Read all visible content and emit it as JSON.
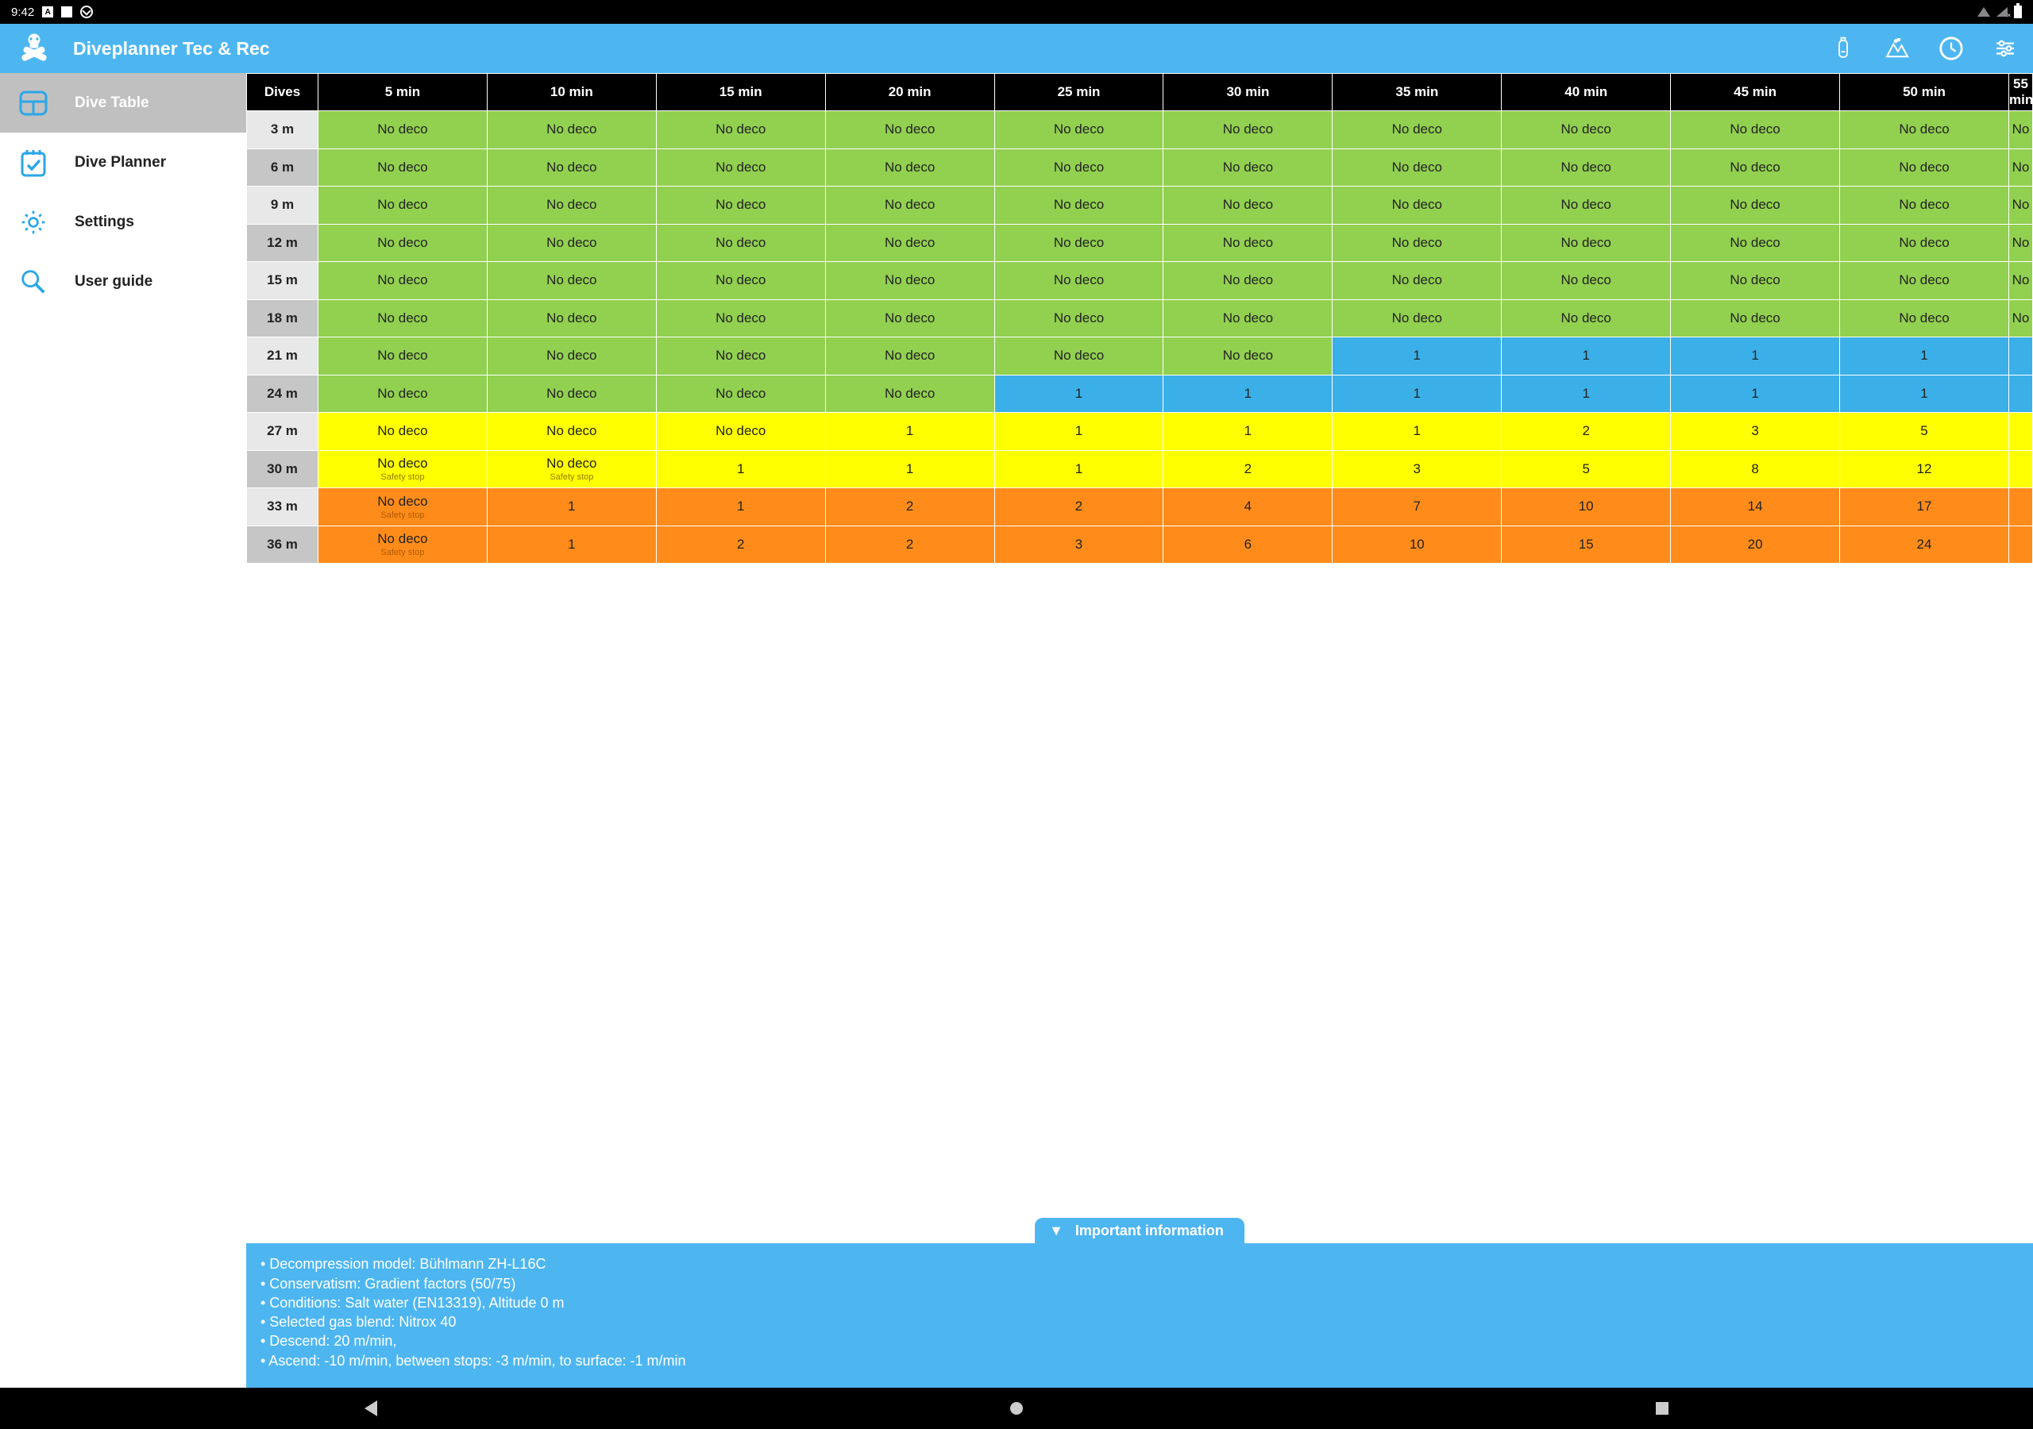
{
  "statusbar": {
    "time": "9:42"
  },
  "appbar": {
    "title": "Diveplanner Tec & Rec",
    "actions": [
      "tank",
      "altitude",
      "history",
      "settings"
    ]
  },
  "sidebar": {
    "items": [
      {
        "id": "dive-table",
        "label": "Dive Table",
        "active": true
      },
      {
        "id": "dive-planner",
        "label": "Dive Planner",
        "active": false
      },
      {
        "id": "settings",
        "label": "Settings",
        "active": false
      },
      {
        "id": "user-guide",
        "label": "User guide",
        "active": false
      }
    ]
  },
  "table": {
    "header_first": "Dives",
    "time_cols": [
      "5 min",
      "10 min",
      "15 min",
      "20 min",
      "25 min",
      "30 min",
      "35 min",
      "40 min",
      "45 min",
      "50 min",
      "55 min"
    ],
    "depths": [
      "3 m",
      "6 m",
      "9 m",
      "12 m",
      "15 m",
      "18 m",
      "21 m",
      "24 m",
      "27 m",
      "30 m",
      "33 m",
      "36 m"
    ],
    "cells": [
      [
        {
          "v": "No deco",
          "c": "nodeco"
        },
        {
          "v": "No deco",
          "c": "nodeco"
        },
        {
          "v": "No deco",
          "c": "nodeco"
        },
        {
          "v": "No deco",
          "c": "nodeco"
        },
        {
          "v": "No deco",
          "c": "nodeco"
        },
        {
          "v": "No deco",
          "c": "nodeco"
        },
        {
          "v": "No deco",
          "c": "nodeco"
        },
        {
          "v": "No deco",
          "c": "nodeco"
        },
        {
          "v": "No deco",
          "c": "nodeco"
        },
        {
          "v": "No deco",
          "c": "nodeco"
        },
        {
          "v": "No",
          "c": "nodeco"
        }
      ],
      [
        {
          "v": "No deco",
          "c": "nodeco"
        },
        {
          "v": "No deco",
          "c": "nodeco"
        },
        {
          "v": "No deco",
          "c": "nodeco"
        },
        {
          "v": "No deco",
          "c": "nodeco"
        },
        {
          "v": "No deco",
          "c": "nodeco"
        },
        {
          "v": "No deco",
          "c": "nodeco"
        },
        {
          "v": "No deco",
          "c": "nodeco"
        },
        {
          "v": "No deco",
          "c": "nodeco"
        },
        {
          "v": "No deco",
          "c": "nodeco"
        },
        {
          "v": "No deco",
          "c": "nodeco"
        },
        {
          "v": "No",
          "c": "nodeco"
        }
      ],
      [
        {
          "v": "No deco",
          "c": "nodeco"
        },
        {
          "v": "No deco",
          "c": "nodeco"
        },
        {
          "v": "No deco",
          "c": "nodeco"
        },
        {
          "v": "No deco",
          "c": "nodeco"
        },
        {
          "v": "No deco",
          "c": "nodeco"
        },
        {
          "v": "No deco",
          "c": "nodeco"
        },
        {
          "v": "No deco",
          "c": "nodeco"
        },
        {
          "v": "No deco",
          "c": "nodeco"
        },
        {
          "v": "No deco",
          "c": "nodeco"
        },
        {
          "v": "No deco",
          "c": "nodeco"
        },
        {
          "v": "No",
          "c": "nodeco"
        }
      ],
      [
        {
          "v": "No deco",
          "c": "nodeco"
        },
        {
          "v": "No deco",
          "c": "nodeco"
        },
        {
          "v": "No deco",
          "c": "nodeco"
        },
        {
          "v": "No deco",
          "c": "nodeco"
        },
        {
          "v": "No deco",
          "c": "nodeco"
        },
        {
          "v": "No deco",
          "c": "nodeco"
        },
        {
          "v": "No deco",
          "c": "nodeco"
        },
        {
          "v": "No deco",
          "c": "nodeco"
        },
        {
          "v": "No deco",
          "c": "nodeco"
        },
        {
          "v": "No deco",
          "c": "nodeco"
        },
        {
          "v": "No",
          "c": "nodeco"
        }
      ],
      [
        {
          "v": "No deco",
          "c": "nodeco"
        },
        {
          "v": "No deco",
          "c": "nodeco"
        },
        {
          "v": "No deco",
          "c": "nodeco"
        },
        {
          "v": "No deco",
          "c": "nodeco"
        },
        {
          "v": "No deco",
          "c": "nodeco"
        },
        {
          "v": "No deco",
          "c": "nodeco"
        },
        {
          "v": "No deco",
          "c": "nodeco"
        },
        {
          "v": "No deco",
          "c": "nodeco"
        },
        {
          "v": "No deco",
          "c": "nodeco"
        },
        {
          "v": "No deco",
          "c": "nodeco"
        },
        {
          "v": "No",
          "c": "nodeco"
        }
      ],
      [
        {
          "v": "No deco",
          "c": "nodeco"
        },
        {
          "v": "No deco",
          "c": "nodeco"
        },
        {
          "v": "No deco",
          "c": "nodeco"
        },
        {
          "v": "No deco",
          "c": "nodeco"
        },
        {
          "v": "No deco",
          "c": "nodeco"
        },
        {
          "v": "No deco",
          "c": "nodeco"
        },
        {
          "v": "No deco",
          "c": "nodeco"
        },
        {
          "v": "No deco",
          "c": "nodeco"
        },
        {
          "v": "No deco",
          "c": "nodeco"
        },
        {
          "v": "No deco",
          "c": "nodeco"
        },
        {
          "v": "No",
          "c": "nodeco"
        }
      ],
      [
        {
          "v": "No deco",
          "c": "nodeco"
        },
        {
          "v": "No deco",
          "c": "nodeco"
        },
        {
          "v": "No deco",
          "c": "nodeco"
        },
        {
          "v": "No deco",
          "c": "nodeco"
        },
        {
          "v": "No deco",
          "c": "nodeco"
        },
        {
          "v": "No deco",
          "c": "nodeco"
        },
        {
          "v": "1",
          "c": "blue"
        },
        {
          "v": "1",
          "c": "blue"
        },
        {
          "v": "1",
          "c": "blue"
        },
        {
          "v": "1",
          "c": "blue"
        },
        {
          "v": "",
          "c": "blue"
        }
      ],
      [
        {
          "v": "No deco",
          "c": "nodeco"
        },
        {
          "v": "No deco",
          "c": "nodeco"
        },
        {
          "v": "No deco",
          "c": "nodeco"
        },
        {
          "v": "No deco",
          "c": "nodeco"
        },
        {
          "v": "1",
          "c": "blue"
        },
        {
          "v": "1",
          "c": "blue"
        },
        {
          "v": "1",
          "c": "blue"
        },
        {
          "v": "1",
          "c": "blue"
        },
        {
          "v": "1",
          "c": "blue"
        },
        {
          "v": "1",
          "c": "blue"
        },
        {
          "v": "",
          "c": "blue"
        }
      ],
      [
        {
          "v": "No deco",
          "c": "yellow"
        },
        {
          "v": "No deco",
          "c": "yellow"
        },
        {
          "v": "No deco",
          "c": "yellow"
        },
        {
          "v": "1",
          "c": "yellow"
        },
        {
          "v": "1",
          "c": "yellow"
        },
        {
          "v": "1",
          "c": "yellow"
        },
        {
          "v": "1",
          "c": "yellow"
        },
        {
          "v": "2",
          "c": "yellow"
        },
        {
          "v": "3",
          "c": "yellow"
        },
        {
          "v": "5",
          "c": "yellow"
        },
        {
          "v": "",
          "c": "yellow"
        }
      ],
      [
        {
          "v": "No deco",
          "c": "yellow",
          "s": "Safety stop"
        },
        {
          "v": "No deco",
          "c": "yellow",
          "s": "Safety stop"
        },
        {
          "v": "1",
          "c": "yellow"
        },
        {
          "v": "1",
          "c": "yellow"
        },
        {
          "v": "1",
          "c": "yellow"
        },
        {
          "v": "2",
          "c": "yellow"
        },
        {
          "v": "3",
          "c": "yellow"
        },
        {
          "v": "5",
          "c": "yellow"
        },
        {
          "v": "8",
          "c": "yellow"
        },
        {
          "v": "12",
          "c": "yellow"
        },
        {
          "v": "",
          "c": "yellow"
        }
      ],
      [
        {
          "v": "No deco",
          "c": "orange",
          "s": "Safety stop"
        },
        {
          "v": "1",
          "c": "orange"
        },
        {
          "v": "1",
          "c": "orange"
        },
        {
          "v": "2",
          "c": "orange"
        },
        {
          "v": "2",
          "c": "orange"
        },
        {
          "v": "4",
          "c": "orange"
        },
        {
          "v": "7",
          "c": "orange"
        },
        {
          "v": "10",
          "c": "orange"
        },
        {
          "v": "14",
          "c": "orange"
        },
        {
          "v": "17",
          "c": "orange"
        },
        {
          "v": "",
          "c": "orange"
        }
      ],
      [
        {
          "v": "No deco",
          "c": "orange",
          "s": "Safety stop"
        },
        {
          "v": "1",
          "c": "orange"
        },
        {
          "v": "2",
          "c": "orange"
        },
        {
          "v": "2",
          "c": "orange"
        },
        {
          "v": "3",
          "c": "orange"
        },
        {
          "v": "6",
          "c": "orange"
        },
        {
          "v": "10",
          "c": "orange"
        },
        {
          "v": "15",
          "c": "orange"
        },
        {
          "v": "20",
          "c": "orange"
        },
        {
          "v": "24",
          "c": "orange"
        },
        {
          "v": "",
          "c": "orange"
        }
      ]
    ]
  },
  "info": {
    "tab_label": "Important information",
    "lines": [
      "• Decompression model: Bühlmann ZH-L16C",
      "• Conservatism: Gradient factors (50/75)",
      "• Conditions: Salt water (EN13319), Altitude 0 m",
      "• Selected gas blend: Nitrox 40",
      "• Descend: 20 m/min,",
      "• Ascend: -10 m/min, between stops: -3 m/min, to surface: -1 m/min"
    ]
  }
}
